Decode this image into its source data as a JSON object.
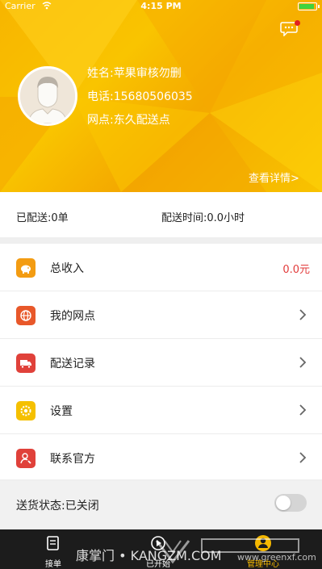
{
  "status_bar": {
    "carrier": "Carrier",
    "time": "4:15 PM"
  },
  "profile": {
    "name": "姓名:苹果审核勿删",
    "phone": "电话:15680506035",
    "outlet": "网点:东久配送点",
    "details_link": "查看详情>"
  },
  "stats": {
    "delivered": "已配送:0单",
    "delivery_time": "配送时间:0.0小时"
  },
  "menu": {
    "items": [
      {
        "label": "总收入",
        "value": "0.0元",
        "icon": "piggy-bank-icon",
        "color": "#f39c12"
      },
      {
        "label": "我的网点",
        "icon": "globe-icon",
        "color": "#e8582a"
      },
      {
        "label": "配送记录",
        "icon": "delivery-truck-icon",
        "color": "#e0413a"
      },
      {
        "label": "设置",
        "icon": "gear-icon",
        "color": "#f5c000"
      },
      {
        "label": "联系官方",
        "icon": "contact-phone-icon",
        "color": "#e0413a"
      }
    ]
  },
  "delivery_status": {
    "label": "送货状态:已关闭",
    "enabled": false
  },
  "tabbar": {
    "tabs": [
      {
        "label": "接单",
        "icon": "order-icon",
        "active": false
      },
      {
        "label": "已开始",
        "icon": "started-icon",
        "active": false
      },
      {
        "label": "管理中心",
        "icon": "user-center-icon",
        "active": true
      }
    ]
  },
  "watermark": {
    "text": "康掌门 • KANGZM.COM",
    "site": "www.greenxf.com"
  },
  "colors": {
    "accent": "#f5b800",
    "value_red": "#e23b3b",
    "tabbar_bg": "#1c1c1c"
  }
}
